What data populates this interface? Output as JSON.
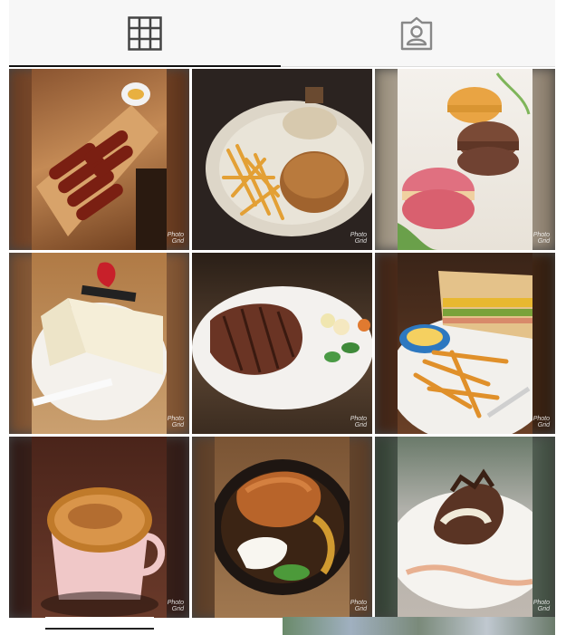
{
  "tabs": [
    {
      "name": "tab-grid",
      "icon": "grid-icon",
      "active": true
    },
    {
      "name": "tab-tagged",
      "icon": "tagged-person-icon",
      "active": false
    }
  ],
  "watermark": {
    "line1": "Photo",
    "line2": "Grid"
  },
  "posts": [
    {
      "id": "post-sausages",
      "subject": "sausages"
    },
    {
      "id": "post-burger-fries",
      "subject": "burger-fries"
    },
    {
      "id": "post-macarons",
      "subject": "macarons"
    },
    {
      "id": "post-strawberry-cake",
      "subject": "strawberry-cake"
    },
    {
      "id": "post-steak",
      "subject": "steak"
    },
    {
      "id": "post-club-sandwich",
      "subject": "club-sandwich"
    },
    {
      "id": "post-creme-brulee-latte",
      "subject": "creme-brulee-latte"
    },
    {
      "id": "post-chicken-curry",
      "subject": "chicken-curry"
    },
    {
      "id": "post-chocolate-dessert",
      "subject": "chocolate-dessert"
    }
  ],
  "colors": {
    "indicator": "#111111",
    "tab_icon": "#444444",
    "tab_icon_inactive": "#888888"
  }
}
